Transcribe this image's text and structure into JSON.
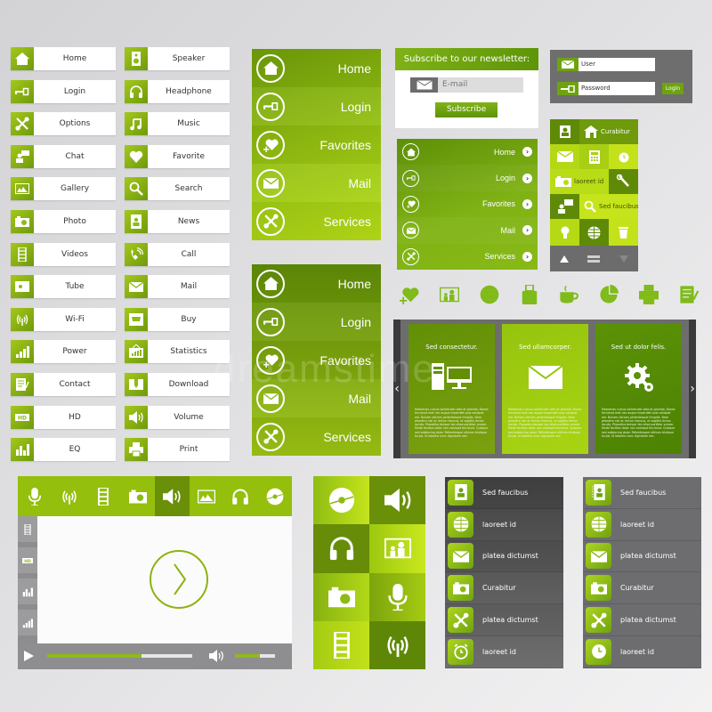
{
  "colors": {
    "accent": "#8dbb14",
    "accent_dark": "#5e9508",
    "panel_gray": "#6e6e6e",
    "panel_dark": "#3a3a3a",
    "background": "#e0e0e2"
  },
  "button_list_left": [
    {
      "label": "Home",
      "icon": "home-icon"
    },
    {
      "label": "Login",
      "icon": "key-icon"
    },
    {
      "label": "Options",
      "icon": "tools-icon"
    },
    {
      "label": "Chat",
      "icon": "chat-icon"
    },
    {
      "label": "Gallery",
      "icon": "gallery-icon"
    },
    {
      "label": "Photo",
      "icon": "camera-icon"
    },
    {
      "label": "Videos",
      "icon": "film-icon"
    },
    {
      "label": "Tube",
      "icon": "tube-icon"
    },
    {
      "label": "Wi-Fi",
      "icon": "wifi-icon"
    },
    {
      "label": "Power",
      "icon": "signal-bars-icon"
    },
    {
      "label": "Contact",
      "icon": "contact-icon"
    },
    {
      "label": "HD",
      "icon": "hd-icon"
    },
    {
      "label": "EQ",
      "icon": "equalizer-icon"
    }
  ],
  "button_list_right": [
    {
      "label": "Speaker",
      "icon": "speaker-icon"
    },
    {
      "label": "Headphone",
      "icon": "headphone-icon"
    },
    {
      "label": "Music",
      "icon": "music-note-icon"
    },
    {
      "label": "Favorite",
      "icon": "heart-icon"
    },
    {
      "label": "Search",
      "icon": "search-icon"
    },
    {
      "label": "News",
      "icon": "news-icon"
    },
    {
      "label": "Call",
      "icon": "phone-icon"
    },
    {
      "label": "Mail",
      "icon": "mail-icon"
    },
    {
      "label": "Buy",
      "icon": "cart-icon"
    },
    {
      "label": "Statistics",
      "icon": "statistics-icon"
    },
    {
      "label": "Download",
      "icon": "download-icon"
    },
    {
      "label": "Volume",
      "icon": "volume-icon"
    },
    {
      "label": "Print",
      "icon": "printer-icon"
    }
  ],
  "big_nav_1": {
    "items": [
      "Home",
      "Login",
      "Favorites",
      "Mail",
      "Services"
    ]
  },
  "big_nav_2": {
    "items": [
      "Home",
      "Login",
      "Favorites",
      "Mail",
      "Services"
    ]
  },
  "newsletter": {
    "title": "Subscribe to our newsletter:",
    "email_placeholder": "E-mail",
    "subscribe_label": "Subscribe"
  },
  "login_box": {
    "user_placeholder": "User",
    "password_placeholder": "Password",
    "login_label": "Login"
  },
  "tile_menu": {
    "labels": [
      "Curabitur",
      "laoreet id",
      "Sed faucibus"
    ]
  },
  "small_nav": {
    "items": [
      "Home",
      "Login",
      "Favorites",
      "Mail",
      "Services"
    ],
    "arrow": "›"
  },
  "icon_strip": [
    "heart-plus-icon",
    "presentation-icon",
    "globe-icon",
    "luggage-icon",
    "coffee-cup-icon",
    "pie-chart-icon",
    "printer-icon",
    "notepad-icon"
  ],
  "slider": {
    "prev": "‹",
    "next": "›",
    "cards": [
      {
        "title": "Sed consectetur.",
        "icon": "computer-icon",
        "body": "Maecenas cursus sollicitudin odio at gravida. Donec tincidunt erat nec augue imperdiet quis volutpat est. Nullam ultrices pellentesque fringilla. Nam pharetra nisl ac lectus rhoncus, ut sagittis lectus iaculis. Phasellus tempor leo vitae porttitor ornare. Morbi facilisis dolor non volutpat tincidunt. Quisque sed adipiscing dolor. Pellentesque ultrices tristique turpis, id lobortis nunc dignissim nec."
      },
      {
        "title": "Sed ullamcorper.",
        "icon": "envelope-icon",
        "body": "Maecenas cursus sollicitudin odio at gravida. Donec tincidunt erat nec augue imperdiet quis volutpat est. Nullam ultrices pellentesque fringilla. Nam pharetra nisl ac lectus rhoncus, ut sagittis lectus iaculis. Phasellus tempor leo vitae porttitor ornare. Morbi facilisis dolor non volutpat tincidunt. Quisque sed adipiscing dolor. Pellentesque ultrices tristique turpis, id lobortis nunc dignissim nec."
      },
      {
        "title": "Sed ut dolor felis.",
        "icon": "settings-gears-icon",
        "body": "Maecenas cursus sollicitudin odio at gravida. Donec tincidunt erat nec augue imperdiet quis volutpat est. Nullam ultrices pellentesque fringilla. Nam pharetra nisl ac lectus rhoncus, ut sagittis lectus iaculis. Phasellus tempor leo vitae porttitor ornare. Morbi facilisis dolor non volutpat tincidunt. Quisque sed adipiscing dolor. Pellentesque ultrices tristique turpis, id lobortis nunc dignissim nec."
      }
    ]
  },
  "media_player": {
    "top_icons": [
      "microphone-icon",
      "wifi-icon",
      "film-icon",
      "camera-icon",
      "volume-icon",
      "gallery-icon",
      "headphone-icon",
      "disc-icon"
    ],
    "active_top_icon": "volume-icon",
    "side_icons": [
      "film-icon",
      "hd-icon",
      "equalizer-icon",
      "signal-bars-icon"
    ],
    "progress": 0.65,
    "volume": 0.62
  },
  "media_grid": [
    "disc-icon",
    "volume-icon",
    "headphone-icon",
    "presentation-icon",
    "camera-icon",
    "microphone-icon",
    "film-icon",
    "wifi-icon"
  ],
  "list_panel_dark": {
    "items": [
      {
        "label": "Sed faucibus",
        "icon": "contact-card-icon"
      },
      {
        "label": "laoreet id",
        "icon": "globe-icon"
      },
      {
        "label": "platea  dictumst",
        "icon": "mail-icon"
      },
      {
        "label": "Curabitur",
        "icon": "camera-icon"
      },
      {
        "label": "platea  dictumst",
        "icon": "tools-icon"
      },
      {
        "label": "laoreet id",
        "icon": "alarm-clock-icon"
      }
    ]
  },
  "list_panel_gray": {
    "items": [
      {
        "label": "Sed faucibus",
        "icon": "notebook-icon"
      },
      {
        "label": "laoreet id",
        "icon": "globe-icon"
      },
      {
        "label": "platea  dictumst",
        "icon": "mail-icon"
      },
      {
        "label": "Curabitur",
        "icon": "camera-icon"
      },
      {
        "label": "platea  dictumst",
        "icon": "tools-icon"
      },
      {
        "label": "laoreet id",
        "icon": "clock-icon"
      }
    ]
  },
  "watermark": "dreamstime"
}
